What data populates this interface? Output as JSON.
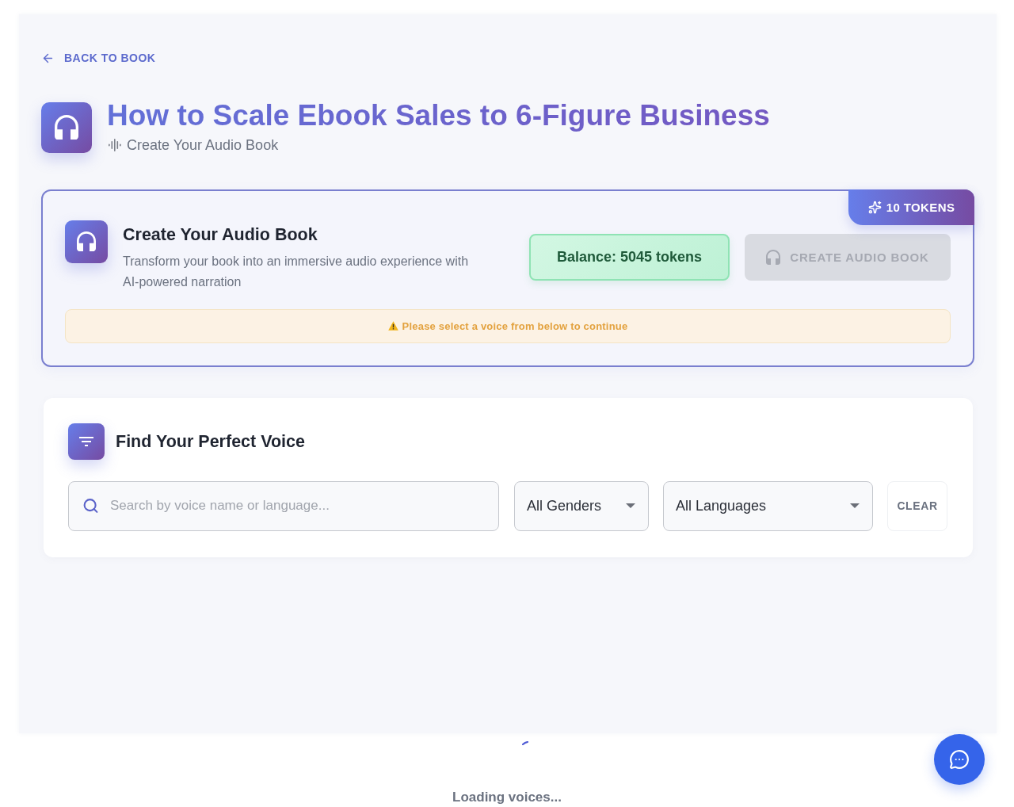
{
  "back_link": {
    "label": "BACK TO BOOK"
  },
  "header": {
    "title": "How to Scale Ebook Sales to 6-Figure Business",
    "subtitle": "Create Your Audio Book"
  },
  "create_card": {
    "token_badge": "10 TOKENS",
    "title": "Create Your Audio Book",
    "description": "Transform your book into an immersive audio experience with AI-powered narration",
    "balance": "Balance: 5045 tokens",
    "create_button": {
      "label": "CREATE AUDIO BOOK",
      "disabled": true
    },
    "warning": "Please select a voice from below to continue"
  },
  "voice_filter": {
    "title": "Find Your Perfect Voice",
    "search": {
      "placeholder": "Search by voice name or language..."
    },
    "selects": [
      {
        "value": "All Genders"
      },
      {
        "value": "All Languages"
      }
    ],
    "clear_button": "CLEAR"
  },
  "loading": {
    "message": "Loading voices..."
  }
}
